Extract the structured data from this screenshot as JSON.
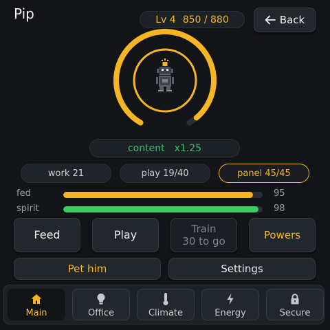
{
  "pet": {
    "name": "Pip"
  },
  "level": {
    "label": "Lv 4",
    "xp_text": "850 / 880",
    "xp_current": 850,
    "xp_max": 880
  },
  "back_label": "Back",
  "mood": {
    "state": "content",
    "multiplier": "x1.25"
  },
  "stats": [
    {
      "label": "work 21",
      "active": false
    },
    {
      "label": "play 19/40",
      "active": false
    },
    {
      "label": "panel 45/45",
      "active": true
    }
  ],
  "bars": [
    {
      "label": "fed",
      "value": 95,
      "value_text": "95",
      "color": "#f5b626"
    },
    {
      "label": "spirit",
      "value": 98,
      "value_text": "98",
      "color": "#3ccc62"
    }
  ],
  "actions": {
    "feed": "Feed",
    "play": "Play",
    "train_line1": "Train",
    "train_line2": "30 to go",
    "powers": "Powers",
    "pet_him": "Pet him",
    "settings": "Settings"
  },
  "nav": [
    {
      "label": "Main",
      "icon": "home-icon",
      "active": true
    },
    {
      "label": "Office",
      "icon": "lightbulb-icon",
      "active": false
    },
    {
      "label": "Climate",
      "icon": "thermometer-icon",
      "active": false
    },
    {
      "label": "Energy",
      "icon": "lightning-icon",
      "active": false
    },
    {
      "label": "Secure",
      "icon": "lock-icon",
      "active": false
    }
  ],
  "colors": {
    "accent": "#f5b626",
    "good": "#36c26a",
    "background": "#121417"
  }
}
